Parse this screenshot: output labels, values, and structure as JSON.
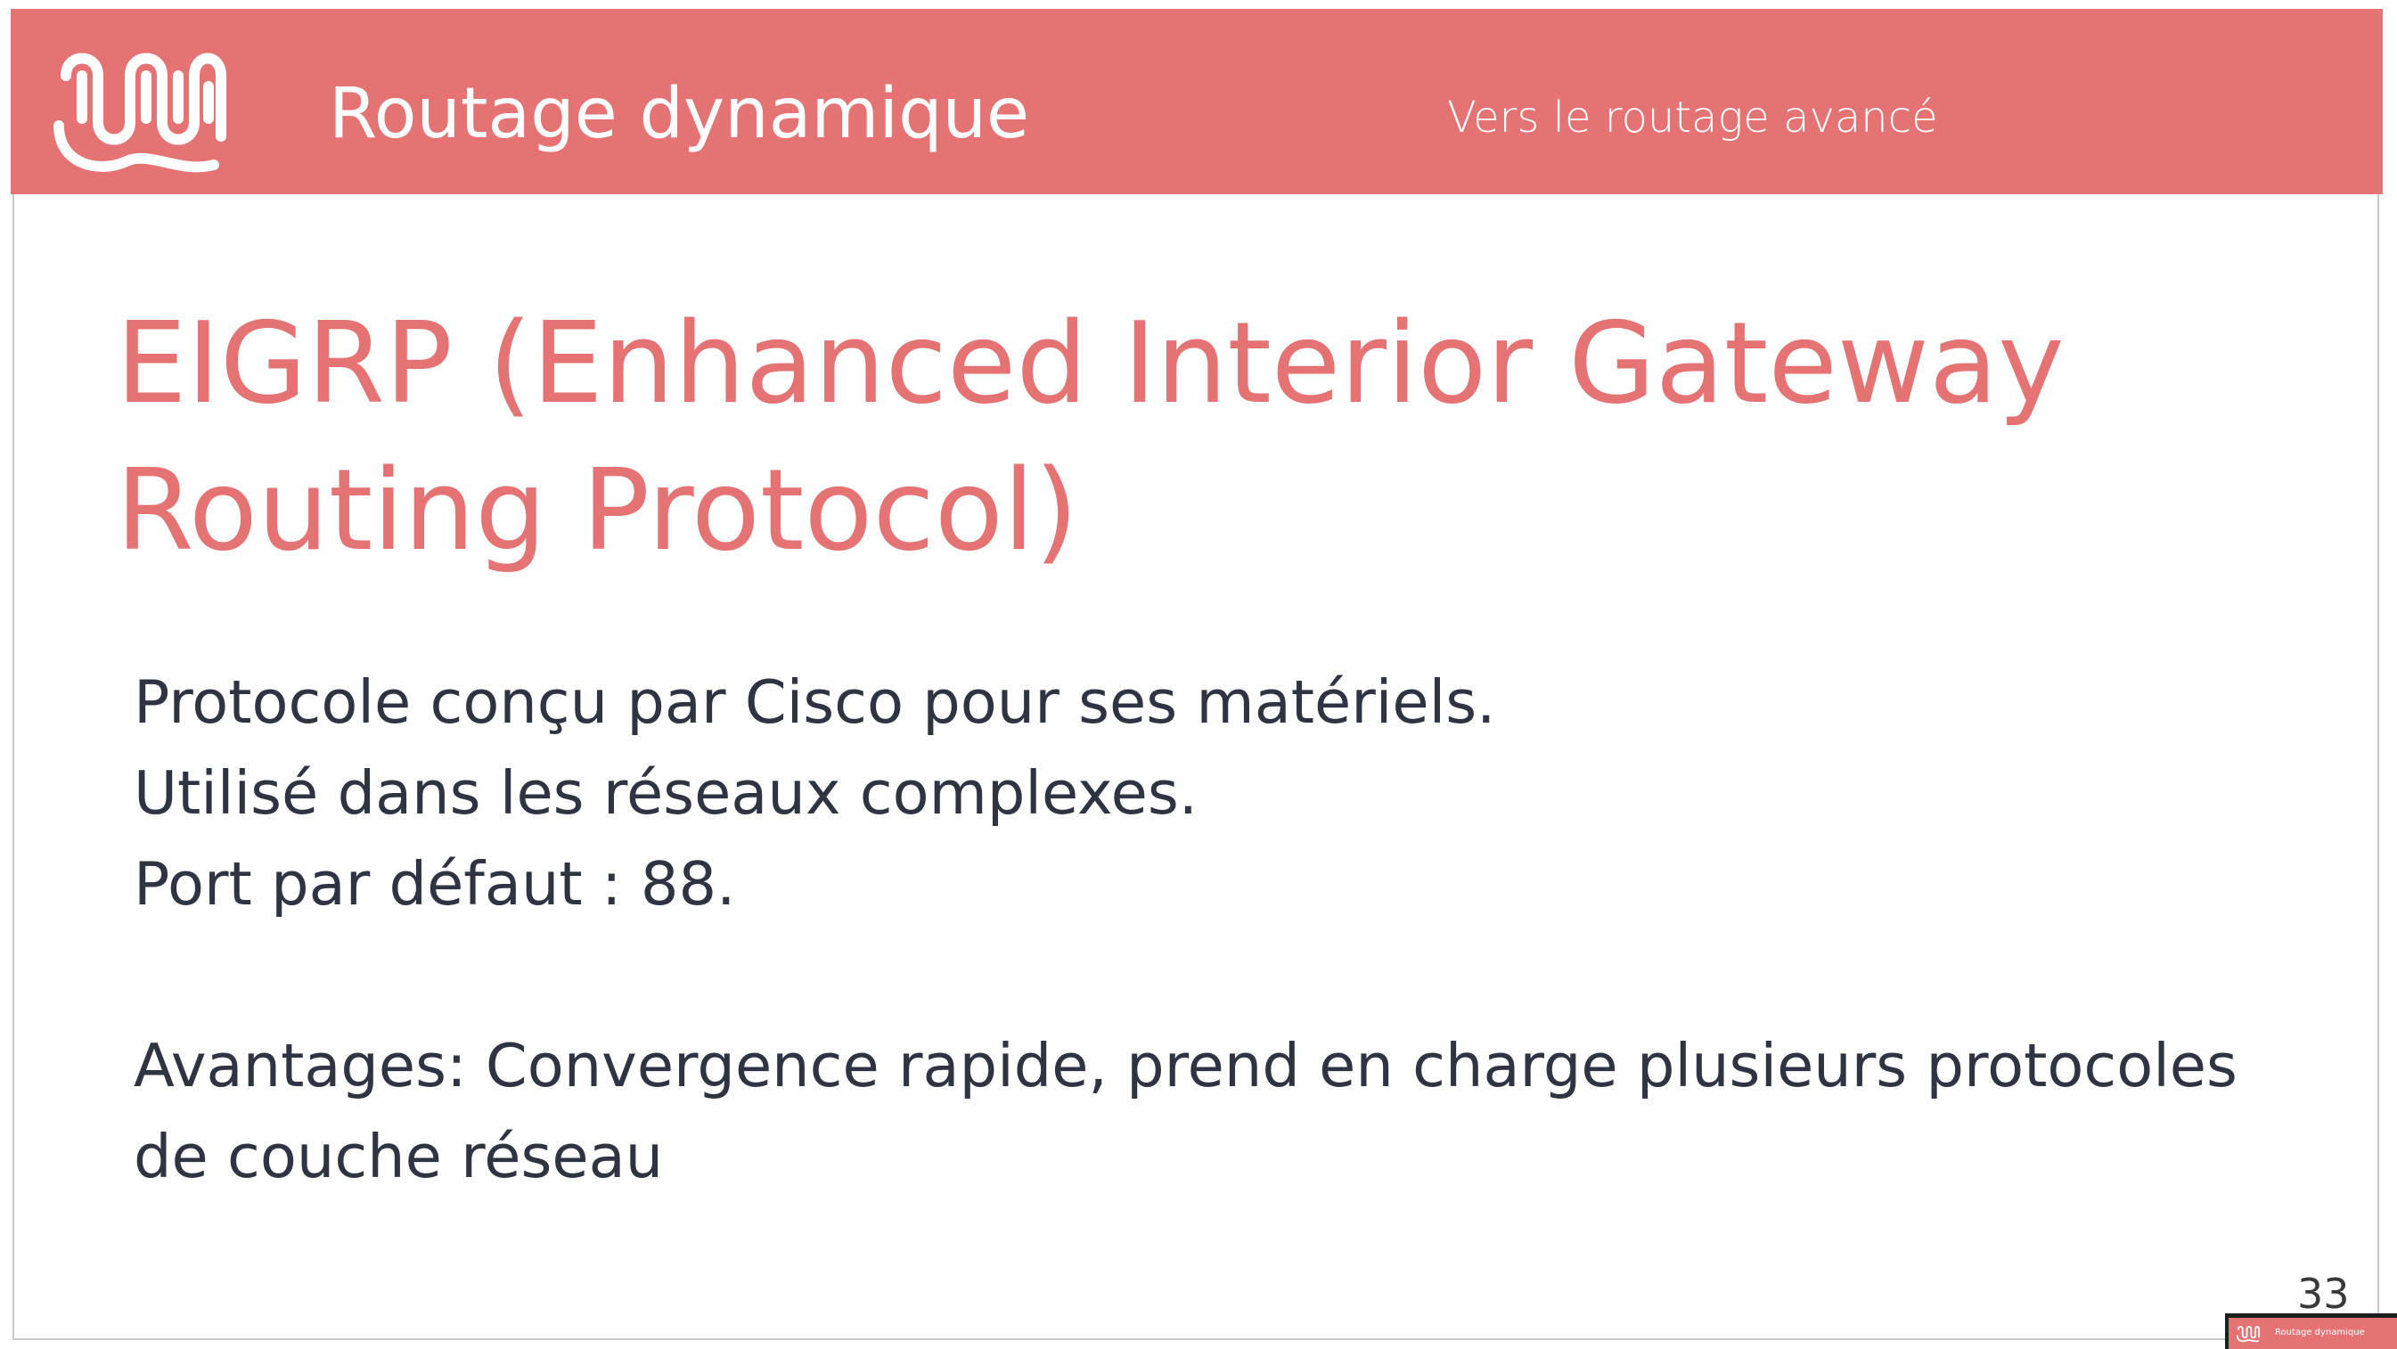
{
  "header": {
    "title": "Routage dynamique",
    "subtitle": "Vers le routage avancé",
    "logo_icon": "squiggle-logo-icon"
  },
  "slide": {
    "title": "EIGRP (Enhanced Interior Gateway Routing Protocol)",
    "lines": [
      "Protocole conçu par Cisco pour ses matériels.",
      "Utilisé dans les réseaux complexes.",
      "Port par défaut : 88."
    ],
    "advantages": "Avantages: Convergence rapide, prend en charge plusieurs protocoles de couche réseau",
    "page_number": "33"
  },
  "thumbnail": {
    "title": "Routage dynamique"
  },
  "colors": {
    "accent": "#e57373",
    "body_text": "#2f3442",
    "background": "#ffffff"
  }
}
